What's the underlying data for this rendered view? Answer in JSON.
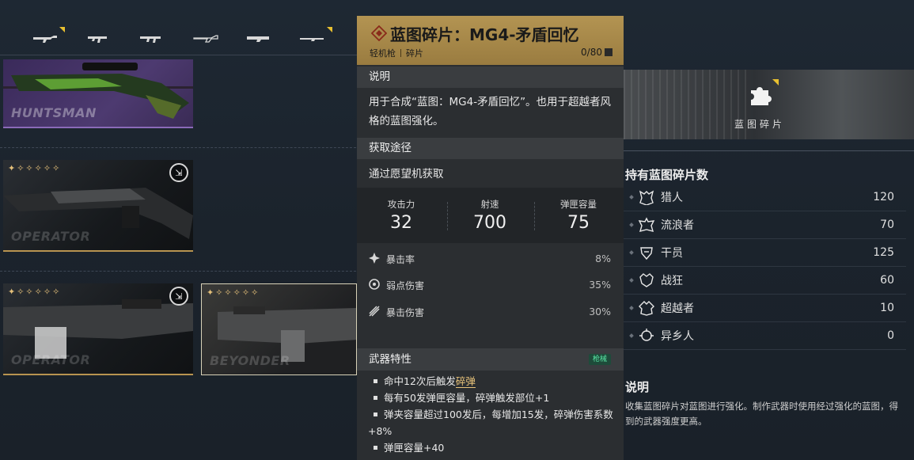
{
  "tabs": [
    {
      "icon": "rifle-icon",
      "selected": true
    },
    {
      "icon": "smg-icon",
      "selected": false
    },
    {
      "icon": "assault-rifle-icon",
      "selected": false
    },
    {
      "icon": "shotgun-icon",
      "selected": false
    },
    {
      "icon": "lmg-icon",
      "selected": false
    },
    {
      "icon": "sniper-icon",
      "selected": true
    }
  ],
  "cards": [
    {
      "brand": "HUNTSMAN",
      "stars": "",
      "badge": ""
    },
    {
      "brand": "OPERATOR",
      "stars": "✦✧✧✧✧✧",
      "badge": "⇲"
    },
    {
      "brand": "OPERATOR",
      "stars": "✦✧✧✧✧✧",
      "badge": "⇲"
    },
    {
      "brand": "BEYONDER",
      "stars": "✦✧✧✧✧✧",
      "badge": ""
    }
  ],
  "tooltip": {
    "title": "蓝图碎片：MG4-矛盾回忆",
    "category": "轻机枪",
    "type": "碎片",
    "count": "0/80",
    "desc_heading": "说明",
    "desc_text": "用于合成“蓝图：MG4-矛盾回忆”。也用于超越者风格的蓝图强化。",
    "source_heading": "获取途径",
    "source_text": "通过愿望机获取",
    "stats": [
      {
        "label": "攻击力",
        "value": "32"
      },
      {
        "label": "射速",
        "value": "700"
      },
      {
        "label": "弹匣容量",
        "value": "75"
      }
    ],
    "substats": [
      {
        "icon": "crit-rate-icon",
        "label": "暴击率",
        "value": "8%"
      },
      {
        "icon": "weakspot-icon",
        "label": "弱点伤害",
        "value": "35%"
      },
      {
        "icon": "crit-damage-icon",
        "label": "暴击伤害",
        "value": "30%"
      }
    ],
    "traits_heading": "武器特性",
    "traits_tag": "枪械",
    "trait1_pre": "命中12次后触发",
    "trait1_hl": "碎弹",
    "trait2": "每有50发弹匣容量，碎弹触发部位+1",
    "trait3": "弹夹容量超过100发后，每增加15发，碎弹伤害系数+8%",
    "trait4": "弹匣容量+40"
  },
  "blueprint_card": {
    "label": "蓝图碎片"
  },
  "holdings": {
    "title": "持有蓝图碎片数",
    "rows": [
      {
        "icon": "hunter-icon",
        "name": "猎人",
        "value": "120"
      },
      {
        "icon": "wanderer-icon",
        "name": "流浪者",
        "value": "70"
      },
      {
        "icon": "operator-icon",
        "name": "干员",
        "value": "125"
      },
      {
        "icon": "berserker-icon",
        "name": "战狂",
        "value": "60"
      },
      {
        "icon": "beyonder-icon",
        "name": "超越者",
        "value": "10"
      },
      {
        "icon": "outlander-icon",
        "name": "异乡人",
        "value": "0"
      }
    ]
  },
  "description": {
    "title": "说明",
    "text": "收集蓝图碎片对蓝图进行强化。制作武器时使用经过强化的蓝图，得到的武器强度更高。"
  },
  "colors": {
    "gold": "#b39452",
    "accent_yellow": "#e8c030",
    "trait_tag": "#58e3a3"
  }
}
